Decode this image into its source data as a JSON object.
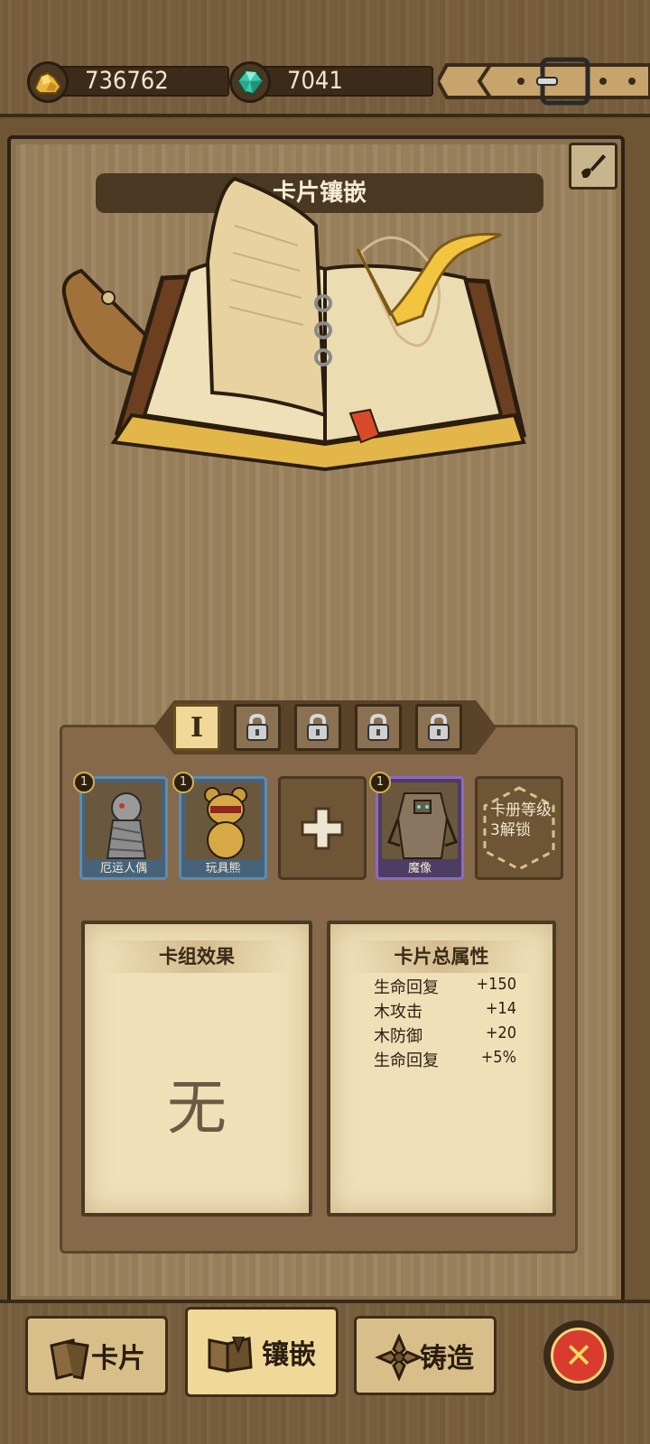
{
  "resources": {
    "gold": {
      "value": "736762",
      "icon": "gold-ore-icon"
    },
    "gems": {
      "value": "7041",
      "icon": "green-gem-icon"
    }
  },
  "panel": {
    "title": "卡片镶嵌",
    "edit_icon": "brush-icon"
  },
  "deck_tabs": [
    {
      "label": "I",
      "state": "selected"
    },
    {
      "label": "",
      "state": "locked",
      "icon": "lock-icon"
    },
    {
      "label": "",
      "state": "locked",
      "icon": "lock-icon"
    },
    {
      "label": "",
      "state": "locked",
      "icon": "lock-icon"
    },
    {
      "label": "",
      "state": "locked",
      "icon": "lock-icon"
    }
  ],
  "card_slots": [
    {
      "type": "card",
      "name": "厄运人偶",
      "level": "1",
      "frame": "blue"
    },
    {
      "type": "card",
      "name": "玩具熊",
      "level": "1",
      "frame": "blue"
    },
    {
      "type": "empty",
      "icon": "plus-icon"
    },
    {
      "type": "card",
      "name": "魔像",
      "level": "1",
      "frame": "purple"
    },
    {
      "type": "locked",
      "text": "卡册等级3解锁"
    }
  ],
  "deck_effect": {
    "title": "卡组效果",
    "value": "无"
  },
  "card_stats": {
    "title": "卡片总属性",
    "rows": [
      {
        "name": "生命回复",
        "value": "+150"
      },
      {
        "name": "木攻击",
        "value": "+14"
      },
      {
        "name": "木防御",
        "value": "+20"
      },
      {
        "name": "生命回复",
        "value": "+5%"
      }
    ]
  },
  "bottom_nav": [
    {
      "label": "卡片",
      "icon": "cards-icon",
      "active": false
    },
    {
      "label": "镶嵌",
      "icon": "inlay-icon",
      "active": true
    },
    {
      "label": "铸造",
      "icon": "forge-icon",
      "active": false
    }
  ],
  "colors": {
    "wood": "#7a6040",
    "paper": "#efe0b8",
    "gold_accent": "#f0d898",
    "close_red": "#d93c2e"
  }
}
